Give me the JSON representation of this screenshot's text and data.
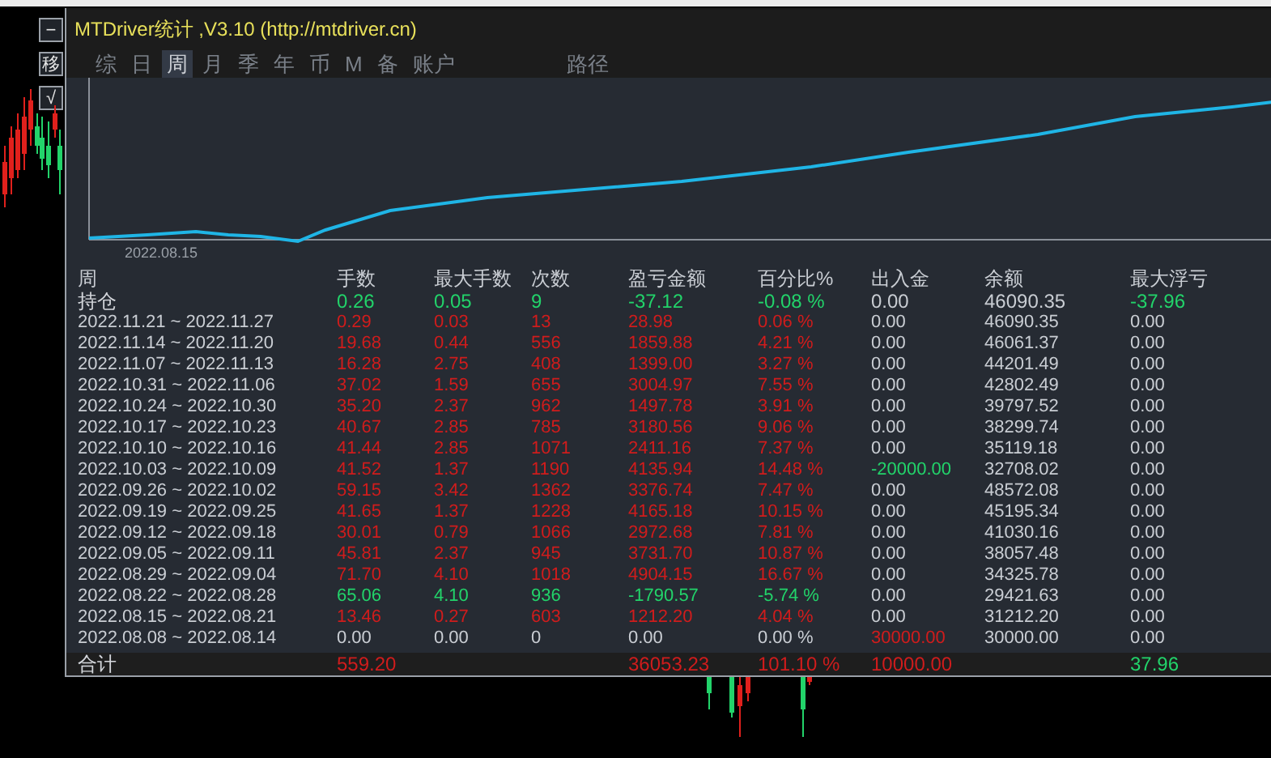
{
  "window": {
    "title": "MTDriver统计 ,V3.10 (http://mtdriver.cn)"
  },
  "side_buttons": [
    "−",
    "移",
    "√"
  ],
  "tabs": [
    {
      "label": "综",
      "selected": false
    },
    {
      "label": "日",
      "selected": false
    },
    {
      "label": "周",
      "selected": true
    },
    {
      "label": "月",
      "selected": false
    },
    {
      "label": "季",
      "selected": false
    },
    {
      "label": "年",
      "selected": false
    },
    {
      "label": "币",
      "selected": false
    },
    {
      "label": "M",
      "selected": false
    },
    {
      "label": "备",
      "selected": false
    },
    {
      "label": "账户",
      "selected": false
    },
    {
      "label": "路径",
      "selected": false
    }
  ],
  "chart": {
    "x_label": "2022.08.15"
  },
  "table": {
    "columns": [
      "周",
      "手数",
      "最大手数",
      "次数",
      "盈亏金额",
      "百分比%",
      "出入金",
      "余额",
      "最大浮亏"
    ],
    "rows": [
      [
        {
          "text": "持仓",
          "color": "#d4d7dc"
        },
        {
          "text": "0.26",
          "color": "#22d36a"
        },
        {
          "text": "0.05",
          "color": "#22d36a"
        },
        {
          "text": "9",
          "color": "#22d36a"
        },
        {
          "text": "-37.12",
          "color": "#22d36a"
        },
        {
          "text": "-0.08 %",
          "color": "#22d36a"
        },
        {
          "text": "0.00",
          "color": "#c9cdd3"
        },
        {
          "text": "46090.35",
          "color": "#c9cdd3"
        },
        {
          "text": "-37.96",
          "color": "#22d36a"
        }
      ],
      [
        {
          "text": "2022.11.21 ~ 2022.11.27",
          "color": "#c9cdd3"
        },
        {
          "text": "0.29",
          "color": "#d01c1c"
        },
        {
          "text": "0.03",
          "color": "#d01c1c"
        },
        {
          "text": "13",
          "color": "#d01c1c"
        },
        {
          "text": "28.98",
          "color": "#d01c1c"
        },
        {
          "text": "0.06 %",
          "color": "#d01c1c"
        },
        {
          "text": "0.00",
          "color": "#c9cdd3"
        },
        {
          "text": "46090.35",
          "color": "#c9cdd3"
        },
        {
          "text": "0.00",
          "color": "#c9cdd3"
        }
      ],
      [
        {
          "text": "2022.11.14 ~ 2022.11.20",
          "color": "#c9cdd3"
        },
        {
          "text": "19.68",
          "color": "#d01c1c"
        },
        {
          "text": "0.44",
          "color": "#d01c1c"
        },
        {
          "text": "556",
          "color": "#d01c1c"
        },
        {
          "text": "1859.88",
          "color": "#d01c1c"
        },
        {
          "text": "4.21 %",
          "color": "#d01c1c"
        },
        {
          "text": "0.00",
          "color": "#c9cdd3"
        },
        {
          "text": "46061.37",
          "color": "#c9cdd3"
        },
        {
          "text": "0.00",
          "color": "#c9cdd3"
        }
      ],
      [
        {
          "text": "2022.11.07 ~ 2022.11.13",
          "color": "#c9cdd3"
        },
        {
          "text": "16.28",
          "color": "#d01c1c"
        },
        {
          "text": "2.75",
          "color": "#d01c1c"
        },
        {
          "text": "408",
          "color": "#d01c1c"
        },
        {
          "text": "1399.00",
          "color": "#d01c1c"
        },
        {
          "text": "3.27 %",
          "color": "#d01c1c"
        },
        {
          "text": "0.00",
          "color": "#c9cdd3"
        },
        {
          "text": "44201.49",
          "color": "#c9cdd3"
        },
        {
          "text": "0.00",
          "color": "#c9cdd3"
        }
      ],
      [
        {
          "text": "2022.10.31 ~ 2022.11.06",
          "color": "#c9cdd3"
        },
        {
          "text": "37.02",
          "color": "#d01c1c"
        },
        {
          "text": "1.59",
          "color": "#d01c1c"
        },
        {
          "text": "655",
          "color": "#d01c1c"
        },
        {
          "text": "3004.97",
          "color": "#d01c1c"
        },
        {
          "text": "7.55 %",
          "color": "#d01c1c"
        },
        {
          "text": "0.00",
          "color": "#c9cdd3"
        },
        {
          "text": "42802.49",
          "color": "#c9cdd3"
        },
        {
          "text": "0.00",
          "color": "#c9cdd3"
        }
      ],
      [
        {
          "text": "2022.10.24 ~ 2022.10.30",
          "color": "#c9cdd3"
        },
        {
          "text": "35.20",
          "color": "#d01c1c"
        },
        {
          "text": "2.37",
          "color": "#d01c1c"
        },
        {
          "text": "962",
          "color": "#d01c1c"
        },
        {
          "text": "1497.78",
          "color": "#d01c1c"
        },
        {
          "text": "3.91 %",
          "color": "#d01c1c"
        },
        {
          "text": "0.00",
          "color": "#c9cdd3"
        },
        {
          "text": "39797.52",
          "color": "#c9cdd3"
        },
        {
          "text": "0.00",
          "color": "#c9cdd3"
        }
      ],
      [
        {
          "text": "2022.10.17 ~ 2022.10.23",
          "color": "#c9cdd3"
        },
        {
          "text": "40.67",
          "color": "#d01c1c"
        },
        {
          "text": "2.85",
          "color": "#d01c1c"
        },
        {
          "text": "785",
          "color": "#d01c1c"
        },
        {
          "text": "3180.56",
          "color": "#d01c1c"
        },
        {
          "text": "9.06 %",
          "color": "#d01c1c"
        },
        {
          "text": "0.00",
          "color": "#c9cdd3"
        },
        {
          "text": "38299.74",
          "color": "#c9cdd3"
        },
        {
          "text": "0.00",
          "color": "#c9cdd3"
        }
      ],
      [
        {
          "text": "2022.10.10 ~ 2022.10.16",
          "color": "#c9cdd3"
        },
        {
          "text": "41.44",
          "color": "#d01c1c"
        },
        {
          "text": "2.85",
          "color": "#d01c1c"
        },
        {
          "text": "1071",
          "color": "#d01c1c"
        },
        {
          "text": "2411.16",
          "color": "#d01c1c"
        },
        {
          "text": "7.37 %",
          "color": "#d01c1c"
        },
        {
          "text": "0.00",
          "color": "#c9cdd3"
        },
        {
          "text": "35119.18",
          "color": "#c9cdd3"
        },
        {
          "text": "0.00",
          "color": "#c9cdd3"
        }
      ],
      [
        {
          "text": "2022.10.03 ~ 2022.10.09",
          "color": "#c9cdd3"
        },
        {
          "text": "41.52",
          "color": "#d01c1c"
        },
        {
          "text": "1.37",
          "color": "#d01c1c"
        },
        {
          "text": "1190",
          "color": "#d01c1c"
        },
        {
          "text": "4135.94",
          "color": "#d01c1c"
        },
        {
          "text": "14.48 %",
          "color": "#d01c1c"
        },
        {
          "text": "-20000.00",
          "color": "#22d36a"
        },
        {
          "text": "32708.02",
          "color": "#c9cdd3"
        },
        {
          "text": "0.00",
          "color": "#c9cdd3"
        }
      ],
      [
        {
          "text": "2022.09.26 ~ 2022.10.02",
          "color": "#c9cdd3"
        },
        {
          "text": "59.15",
          "color": "#d01c1c"
        },
        {
          "text": "3.42",
          "color": "#d01c1c"
        },
        {
          "text": "1362",
          "color": "#d01c1c"
        },
        {
          "text": "3376.74",
          "color": "#d01c1c"
        },
        {
          "text": "7.47 %",
          "color": "#d01c1c"
        },
        {
          "text": "0.00",
          "color": "#c9cdd3"
        },
        {
          "text": "48572.08",
          "color": "#c9cdd3"
        },
        {
          "text": "0.00",
          "color": "#c9cdd3"
        }
      ],
      [
        {
          "text": "2022.09.19 ~ 2022.09.25",
          "color": "#c9cdd3"
        },
        {
          "text": "41.65",
          "color": "#d01c1c"
        },
        {
          "text": "1.37",
          "color": "#d01c1c"
        },
        {
          "text": "1228",
          "color": "#d01c1c"
        },
        {
          "text": "4165.18",
          "color": "#d01c1c"
        },
        {
          "text": "10.15 %",
          "color": "#d01c1c"
        },
        {
          "text": "0.00",
          "color": "#c9cdd3"
        },
        {
          "text": "45195.34",
          "color": "#c9cdd3"
        },
        {
          "text": "0.00",
          "color": "#c9cdd3"
        }
      ],
      [
        {
          "text": "2022.09.12 ~ 2022.09.18",
          "color": "#c9cdd3"
        },
        {
          "text": "30.01",
          "color": "#d01c1c"
        },
        {
          "text": "0.79",
          "color": "#d01c1c"
        },
        {
          "text": "1066",
          "color": "#d01c1c"
        },
        {
          "text": "2972.68",
          "color": "#d01c1c"
        },
        {
          "text": "7.81 %",
          "color": "#d01c1c"
        },
        {
          "text": "0.00",
          "color": "#c9cdd3"
        },
        {
          "text": "41030.16",
          "color": "#c9cdd3"
        },
        {
          "text": "0.00",
          "color": "#c9cdd3"
        }
      ],
      [
        {
          "text": "2022.09.05 ~ 2022.09.11",
          "color": "#c9cdd3"
        },
        {
          "text": "45.81",
          "color": "#d01c1c"
        },
        {
          "text": "2.37",
          "color": "#d01c1c"
        },
        {
          "text": "945",
          "color": "#d01c1c"
        },
        {
          "text": "3731.70",
          "color": "#d01c1c"
        },
        {
          "text": "10.87 %",
          "color": "#d01c1c"
        },
        {
          "text": "0.00",
          "color": "#c9cdd3"
        },
        {
          "text": "38057.48",
          "color": "#c9cdd3"
        },
        {
          "text": "0.00",
          "color": "#c9cdd3"
        }
      ],
      [
        {
          "text": "2022.08.29 ~ 2022.09.04",
          "color": "#c9cdd3"
        },
        {
          "text": "71.70",
          "color": "#d01c1c"
        },
        {
          "text": "4.10",
          "color": "#d01c1c"
        },
        {
          "text": "1018",
          "color": "#d01c1c"
        },
        {
          "text": "4904.15",
          "color": "#d01c1c"
        },
        {
          "text": "16.67 %",
          "color": "#d01c1c"
        },
        {
          "text": "0.00",
          "color": "#c9cdd3"
        },
        {
          "text": "34325.78",
          "color": "#c9cdd3"
        },
        {
          "text": "0.00",
          "color": "#c9cdd3"
        }
      ],
      [
        {
          "text": "2022.08.22 ~ 2022.08.28",
          "color": "#c9cdd3"
        },
        {
          "text": "65.06",
          "color": "#22d36a"
        },
        {
          "text": "4.10",
          "color": "#22d36a"
        },
        {
          "text": "936",
          "color": "#22d36a"
        },
        {
          "text": "-1790.57",
          "color": "#22d36a"
        },
        {
          "text": "-5.74 %",
          "color": "#22d36a"
        },
        {
          "text": "0.00",
          "color": "#c9cdd3"
        },
        {
          "text": "29421.63",
          "color": "#c9cdd3"
        },
        {
          "text": "0.00",
          "color": "#c9cdd3"
        }
      ],
      [
        {
          "text": "2022.08.15 ~ 2022.08.21",
          "color": "#c9cdd3"
        },
        {
          "text": "13.46",
          "color": "#d01c1c"
        },
        {
          "text": "0.27",
          "color": "#d01c1c"
        },
        {
          "text": "603",
          "color": "#d01c1c"
        },
        {
          "text": "1212.20",
          "color": "#d01c1c"
        },
        {
          "text": "4.04 %",
          "color": "#d01c1c"
        },
        {
          "text": "0.00",
          "color": "#c9cdd3"
        },
        {
          "text": "31212.20",
          "color": "#c9cdd3"
        },
        {
          "text": "0.00",
          "color": "#c9cdd3"
        }
      ],
      [
        {
          "text": "2022.08.08 ~ 2022.08.14",
          "color": "#c9cdd3"
        },
        {
          "text": "0.00",
          "color": "#c9cdd3"
        },
        {
          "text": "0.00",
          "color": "#c9cdd3"
        },
        {
          "text": "0",
          "color": "#c9cdd3"
        },
        {
          "text": "0.00",
          "color": "#c9cdd3"
        },
        {
          "text": "0.00 %",
          "color": "#c9cdd3"
        },
        {
          "text": "30000.00",
          "color": "#d01c1c"
        },
        {
          "text": "30000.00",
          "color": "#c9cdd3"
        },
        {
          "text": "0.00",
          "color": "#c9cdd3"
        }
      ]
    ],
    "total": {
      "label": {
        "text": "合计",
        "color": "#d4d7dc"
      },
      "lots": {
        "text": "559.20",
        "color": "#d01c1c"
      },
      "profit": {
        "text": "36053.23",
        "color": "#d01c1c"
      },
      "percent": {
        "text": "101.10 %",
        "color": "#d01c1c"
      },
      "deposit": {
        "text": "10000.00",
        "color": "#d01c1c"
      },
      "max_floating_loss": {
        "text": "37.96",
        "color": "#22d36a"
      }
    }
  }
}
